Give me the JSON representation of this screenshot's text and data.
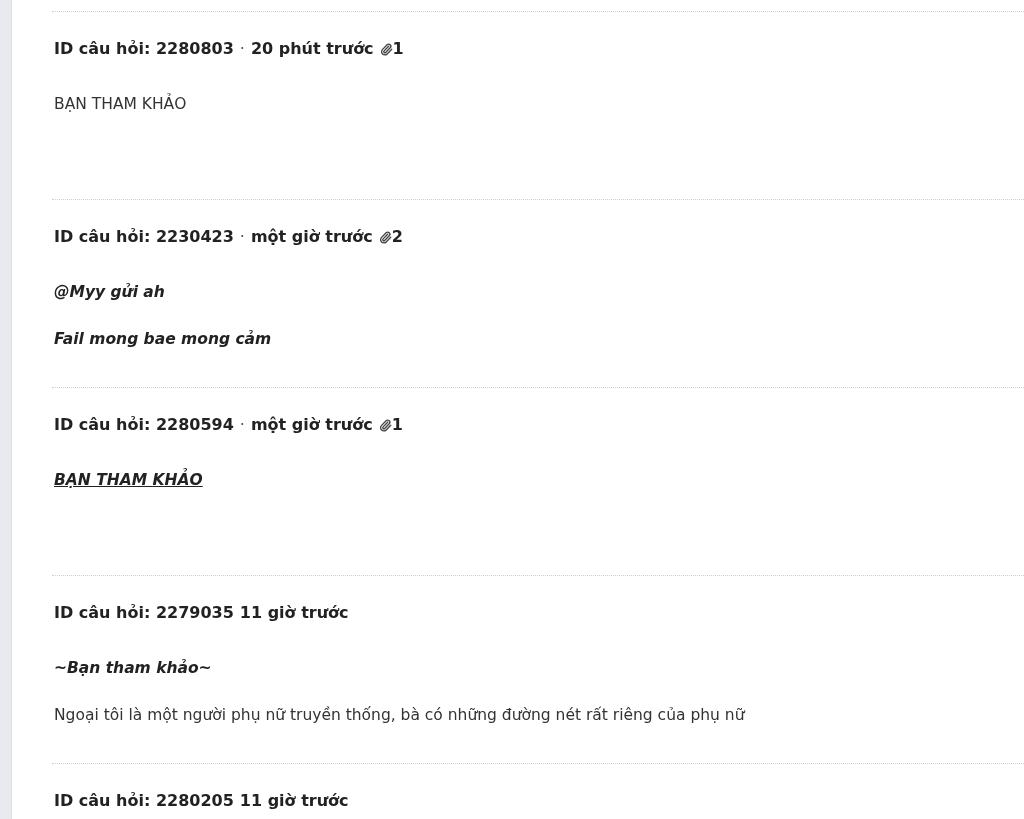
{
  "questions": [
    {
      "id_label": "ID câu hỏi: 2280803",
      "separator": "·",
      "time": "20 phút trước",
      "attachments": "1",
      "blank_line_after": true,
      "lines": [
        {
          "kind": "plain",
          "text": "BẠN THAM KHẢO"
        }
      ]
    },
    {
      "id_label": "ID câu hỏi: 2230423",
      "separator": "·",
      "time": "một giờ trước",
      "attachments": "2",
      "blank_line_after": false,
      "lines": [
        {
          "kind": "bold-italic",
          "text": "@Myy gửi ah"
        },
        {
          "kind": "bold-italic",
          "text": "Fail mong bae mong cảm"
        }
      ]
    },
    {
      "id_label": "ID câu hỏi: 2280594",
      "separator": "·",
      "time": "một giờ trước",
      "attachments": "1",
      "blank_line_after": true,
      "lines": [
        {
          "kind": "bold-italic-underline",
          "text": "BẠN THAM KHẢO"
        }
      ]
    },
    {
      "id_label": "ID câu hỏi: 2279035",
      "time": "11 giờ trước",
      "blank_line_after": false,
      "lines": [
        {
          "kind": "bold-italic",
          "text": "~Bạn tham khảo~"
        },
        {
          "kind": "plain",
          "text": "Ngoại tôi là một người phụ nữ truyền thống, bà có những đường nét rất riêng của phụ nữ"
        }
      ]
    },
    {
      "id_label": "ID câu hỏi: 2280205",
      "time": "11 giờ trước"
    }
  ]
}
